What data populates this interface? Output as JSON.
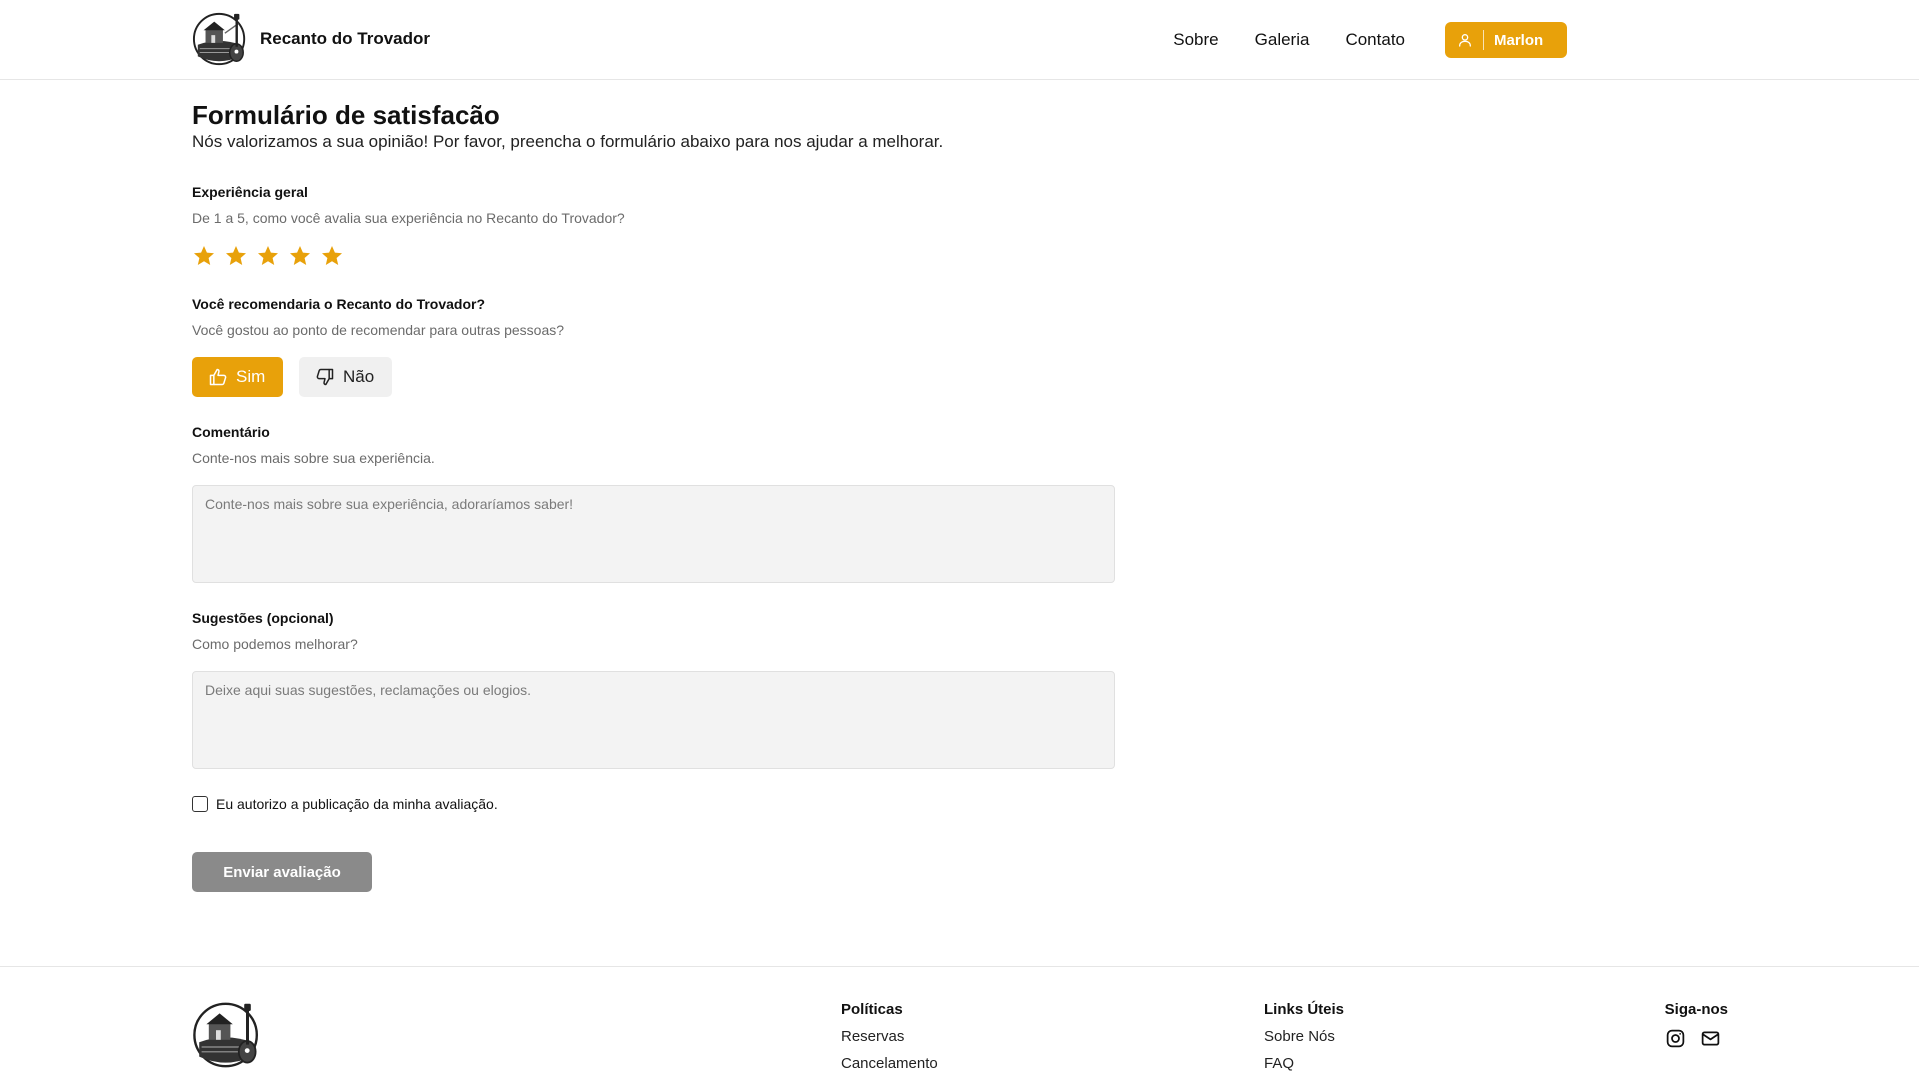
{
  "header": {
    "brand_name": "Recanto do Trovador",
    "nav": [
      {
        "label": "Sobre"
      },
      {
        "label": "Galeria"
      },
      {
        "label": "Contato"
      }
    ],
    "user_button_label": "Marlon"
  },
  "form": {
    "title": "Formulário de satisfacão",
    "subtitle": "Nós valorizamos a sua opinião! Por favor, preencha o formulário abaixo para nos ajudar a melhorar.",
    "experience": {
      "label": "Experiência geral",
      "help": "De 1 a 5, como você avalia sua experiência no Recanto do Trovador?",
      "rating": 5,
      "max_rating": 5
    },
    "recommend": {
      "label": "Você recomendaria o Recanto do Trovador?",
      "help": "Você gostou ao ponto de recomendar para outras pessoas?",
      "yes_label": "Sim",
      "no_label": "Não",
      "selected": "yes"
    },
    "comment": {
      "label": "Comentário",
      "help": "Conte-nos mais sobre sua experiência.",
      "placeholder": "Conte-nos mais sobre sua experiência, adoraríamos saber!",
      "value": ""
    },
    "suggestions": {
      "label": "Sugestões (opcional)",
      "help": "Como podemos melhorar?",
      "placeholder": "Deixe aqui suas sugestões, reclamações ou elogios.",
      "value": ""
    },
    "consent_label": "Eu autorizo a publicação da minha avaliação.",
    "consent_checked": false,
    "submit_label": "Enviar avaliação"
  },
  "footer": {
    "policies": {
      "title": "Políticas",
      "links": [
        {
          "label": "Reservas"
        },
        {
          "label": "Cancelamento"
        }
      ]
    },
    "useful_links": {
      "title": "Links Úteis",
      "links": [
        {
          "label": "Sobre Nós"
        },
        {
          "label": "FAQ"
        }
      ]
    },
    "social": {
      "title": "Siga-nos",
      "icons": [
        "instagram-icon",
        "mail-icon"
      ]
    }
  },
  "colors": {
    "accent": "#e8a10a",
    "submit_disabled": "#8a8a8a",
    "field_bg": "#f3f3f3"
  }
}
